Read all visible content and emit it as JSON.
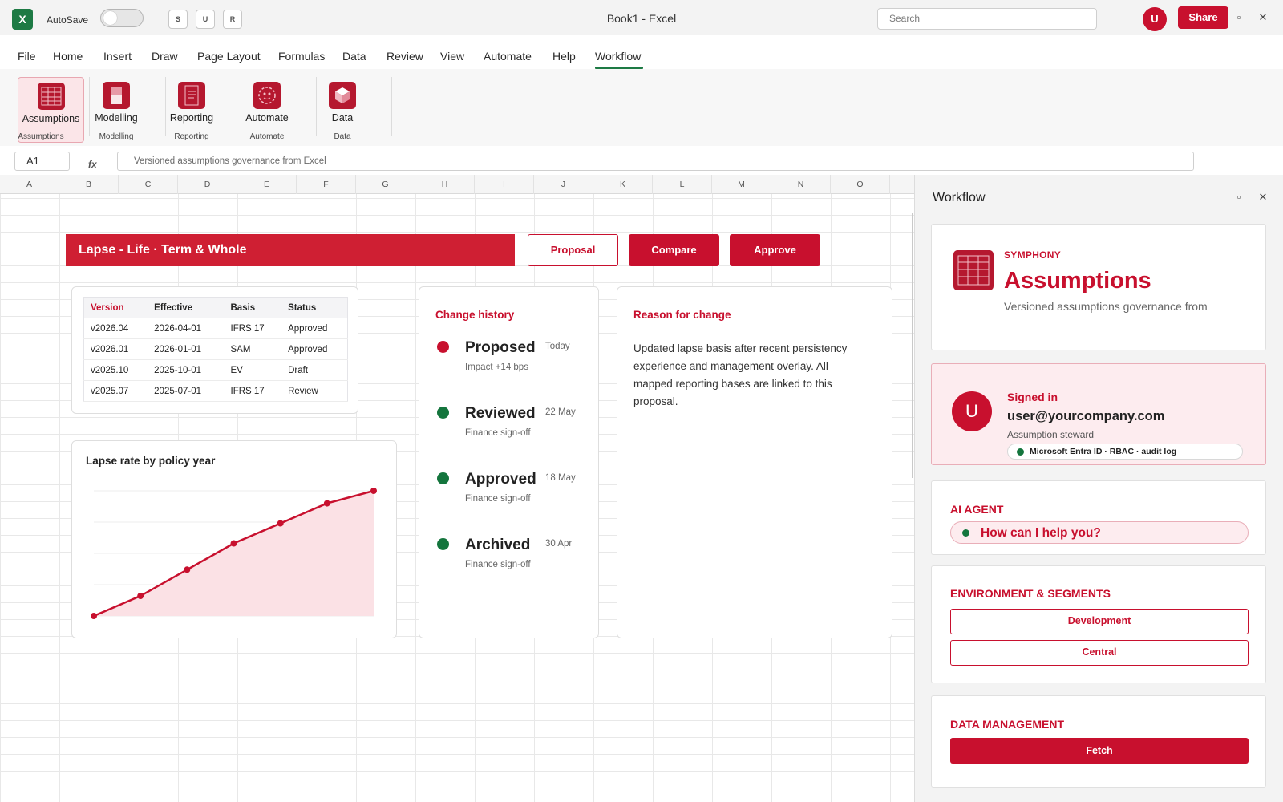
{
  "titlebar": {
    "app_icon": "X",
    "autosave_label": "AutoSave",
    "quick_access": [
      "S",
      "U",
      "R"
    ],
    "window_title": "Book1 - Excel",
    "search_placeholder": "Search",
    "avatar_initial": "U",
    "share_label": "Share",
    "minimize_glyph": "▫",
    "close_glyph": "✕"
  },
  "menu": {
    "items": [
      "File",
      "Home",
      "Insert",
      "Draw",
      "Page Layout",
      "Formulas",
      "Data",
      "Review",
      "View",
      "Automate",
      "Help",
      "Workflow"
    ],
    "active": "Workflow"
  },
  "ribbon": {
    "groups": [
      {
        "label": "Assumptions",
        "group": "Assumptions",
        "icon": "assumptions-icon",
        "selected": true
      },
      {
        "label": "Modelling",
        "group": "Modelling",
        "icon": "modelling-icon"
      },
      {
        "label": "Reporting",
        "group": "Reporting",
        "icon": "reporting-icon"
      },
      {
        "label": "Automate",
        "group": "Automate",
        "icon": "automate-icon"
      },
      {
        "label": "Data",
        "group": "Data",
        "icon": "data-cube-icon"
      }
    ]
  },
  "formula_bar": {
    "name_box": "A1",
    "fx": "fx",
    "formula": "Versioned assumptions governance from Excel"
  },
  "columns": [
    "A",
    "B",
    "C",
    "D",
    "E",
    "F",
    "G",
    "H",
    "I",
    "J",
    "K",
    "L",
    "M",
    "N",
    "O"
  ],
  "sheet": {
    "banner": "Lapse - Life · Term & Whole",
    "buttons": {
      "proposal": "Proposal",
      "compare": "Compare",
      "approve": "Approve"
    },
    "versions": {
      "headers": [
        "Version",
        "Effective",
        "Basis",
        "Status"
      ],
      "rows": [
        [
          "v2026.04",
          "2026-04-01",
          "IFRS 17",
          "Approved"
        ],
        [
          "v2026.01",
          "2026-01-01",
          "SAM",
          "Approved"
        ],
        [
          "v2025.10",
          "2025-10-01",
          "EV",
          "Draft"
        ],
        [
          "v2025.07",
          "2025-07-01",
          "IFRS 17",
          "Review"
        ]
      ]
    },
    "history": {
      "title": "Change history",
      "items": [
        {
          "status": "Proposed",
          "date": "Today",
          "sub": "Impact +14 bps",
          "color": "#c8102e"
        },
        {
          "status": "Reviewed",
          "date": "22 May",
          "sub": "Finance sign-off",
          "color": "#14753d"
        },
        {
          "status": "Approved",
          "date": "18 May",
          "sub": "Finance sign-off",
          "color": "#14753d"
        },
        {
          "status": "Archived",
          "date": "30 Apr",
          "sub": "Finance sign-off",
          "color": "#14753d"
        }
      ]
    },
    "reason": {
      "title": "Reason for change",
      "text": "Updated lapse basis after recent persistency experience and management overlay. All mapped reporting bases are linked to this proposal."
    }
  },
  "chart_data": {
    "type": "area",
    "title": "Lapse rate by policy year",
    "xlabel": "",
    "ylabel": "",
    "x": [
      1,
      2,
      3,
      4,
      5,
      6,
      7
    ],
    "values": [
      0,
      0.16,
      0.37,
      0.58,
      0.74,
      0.9,
      1.0
    ],
    "ylim": [
      0,
      1
    ],
    "grid": true,
    "color": "#c8102e",
    "fill": "#fbe1e5"
  },
  "panel": {
    "title": "Workflow",
    "minimize_glyph": "▫",
    "close_glyph": "✕",
    "brand": {
      "name": "SYMPHONY",
      "title": "Assumptions",
      "subtitle": "Versioned assumptions governance from Excel"
    },
    "signed_in": {
      "label": "Signed in",
      "email": "user@yourcompany.com",
      "role": "Assumption steward",
      "auth": "Microsoft Entra ID · RBAC · audit log",
      "avatar_initial": "U"
    },
    "ai_agent": {
      "heading": "AI AGENT",
      "placeholder": "How can I help you?"
    },
    "environment": {
      "heading": "ENVIRONMENT & SEGMENTS",
      "options": [
        "Development",
        "Central"
      ]
    },
    "data_management": {
      "heading": "DATA MANAGEMENT",
      "fetch_label": "Fetch"
    }
  },
  "colors": {
    "brand_red": "#c8102e",
    "excel_green": "#1d7a44",
    "status_green": "#14753d"
  }
}
